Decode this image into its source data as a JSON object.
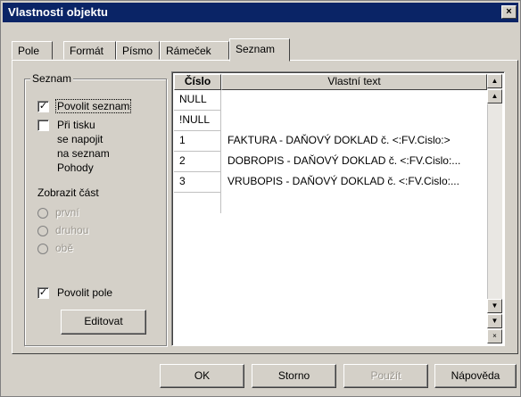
{
  "window": {
    "title": "Vlastnosti objektu",
    "close_label": "×"
  },
  "tabs": [
    {
      "label": "Pole"
    },
    {
      "label": "Formát"
    },
    {
      "label": "Písmo"
    },
    {
      "label": "Rámeček"
    },
    {
      "label": "Seznam",
      "active": true
    }
  ],
  "seznam": {
    "group_title": "Seznam",
    "povolit_seznam": {
      "label": "Povolit seznam",
      "checked": true
    },
    "pri_tisku": {
      "label_lines": [
        "Při tisku",
        "se napojit",
        "na seznam",
        "Pohody"
      ],
      "checked": false
    },
    "zobrazit_label": "Zobrazit část",
    "radios": [
      "první",
      "druhou",
      "obě"
    ],
    "povolit_pole": {
      "label": "Povolit pole",
      "checked": true
    },
    "editovat_label": "Editovat"
  },
  "grid": {
    "col_cislo": "Číslo",
    "col_text": "Vlastní text",
    "rows": [
      {
        "cislo": "NULL",
        "text": ""
      },
      {
        "cislo": "!NULL",
        "text": ""
      },
      {
        "cislo": "1",
        "text": "FAKTURA - DAŇOVÝ DOKLAD č. <:FV.Cislo:>"
      },
      {
        "cislo": "2",
        "text": "DOBROPIS - DAŇOVÝ DOKLAD č. <:FV.Cislo:..."
      },
      {
        "cislo": "3",
        "text": "VRUBOPIS - DAŇOVÝ DOKLAD č. <:FV.Cislo:..."
      }
    ]
  },
  "buttons": {
    "ok": "OK",
    "storno": "Storno",
    "pouzit": "Použít",
    "napoveda": "Nápověda"
  }
}
